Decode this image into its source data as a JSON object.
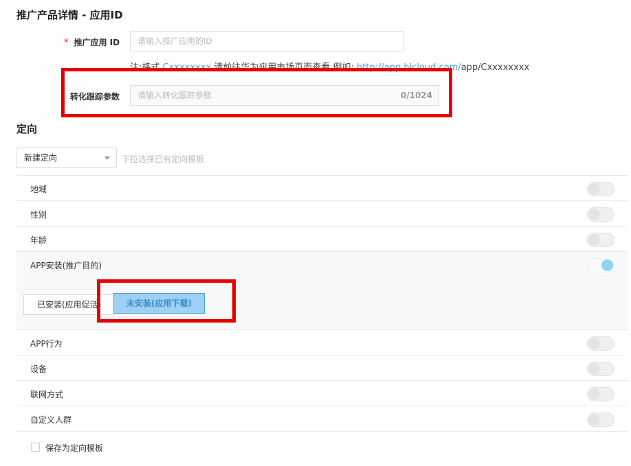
{
  "promo": {
    "title": "推广产品详情 - 应用ID",
    "app_id_required": "*",
    "app_id_label": "推广应用 ID",
    "app_id_placeholder": "请输入推广应用的ID",
    "note_prefix": "注:格式 ",
    "note_format": "Cxxxxxxxx",
    "note_middle": " 请前往华为应用市场页面查看 例如: ",
    "note_url": "http://app.hicloud.com/",
    "note_suffix": "app/Cxxxxxxxx",
    "tracking_label": "转化跟踪参数",
    "tracking_placeholder": "请输入转化跟踪参数",
    "tracking_counter": "0/1024"
  },
  "targeting": {
    "title": "定向",
    "select_value": "新建定向",
    "select_hint": "下拉选择已有定向模板",
    "rows": [
      {
        "label": "地域",
        "on": false
      },
      {
        "label": "性别",
        "on": false
      },
      {
        "label": "年龄",
        "on": false
      },
      {
        "label": "APP安装(推广目的)",
        "on": true
      },
      {
        "label": "APP行为",
        "on": false
      },
      {
        "label": "设备",
        "on": false
      },
      {
        "label": "联网方式",
        "on": false
      },
      {
        "label": "自定义人群",
        "on": false
      }
    ],
    "install_options": [
      "已安装(应用促活)",
      "未安装(应用下载)"
    ],
    "selected_install_option": "未安装(应用下载)",
    "save_template_label": "保存为定向模板"
  },
  "colors": {
    "highlight_box": "#e80000",
    "link": "#4a9fd9",
    "toggle_on": "#8ed4ef",
    "selected_option_bg": "#9ed0f3"
  }
}
